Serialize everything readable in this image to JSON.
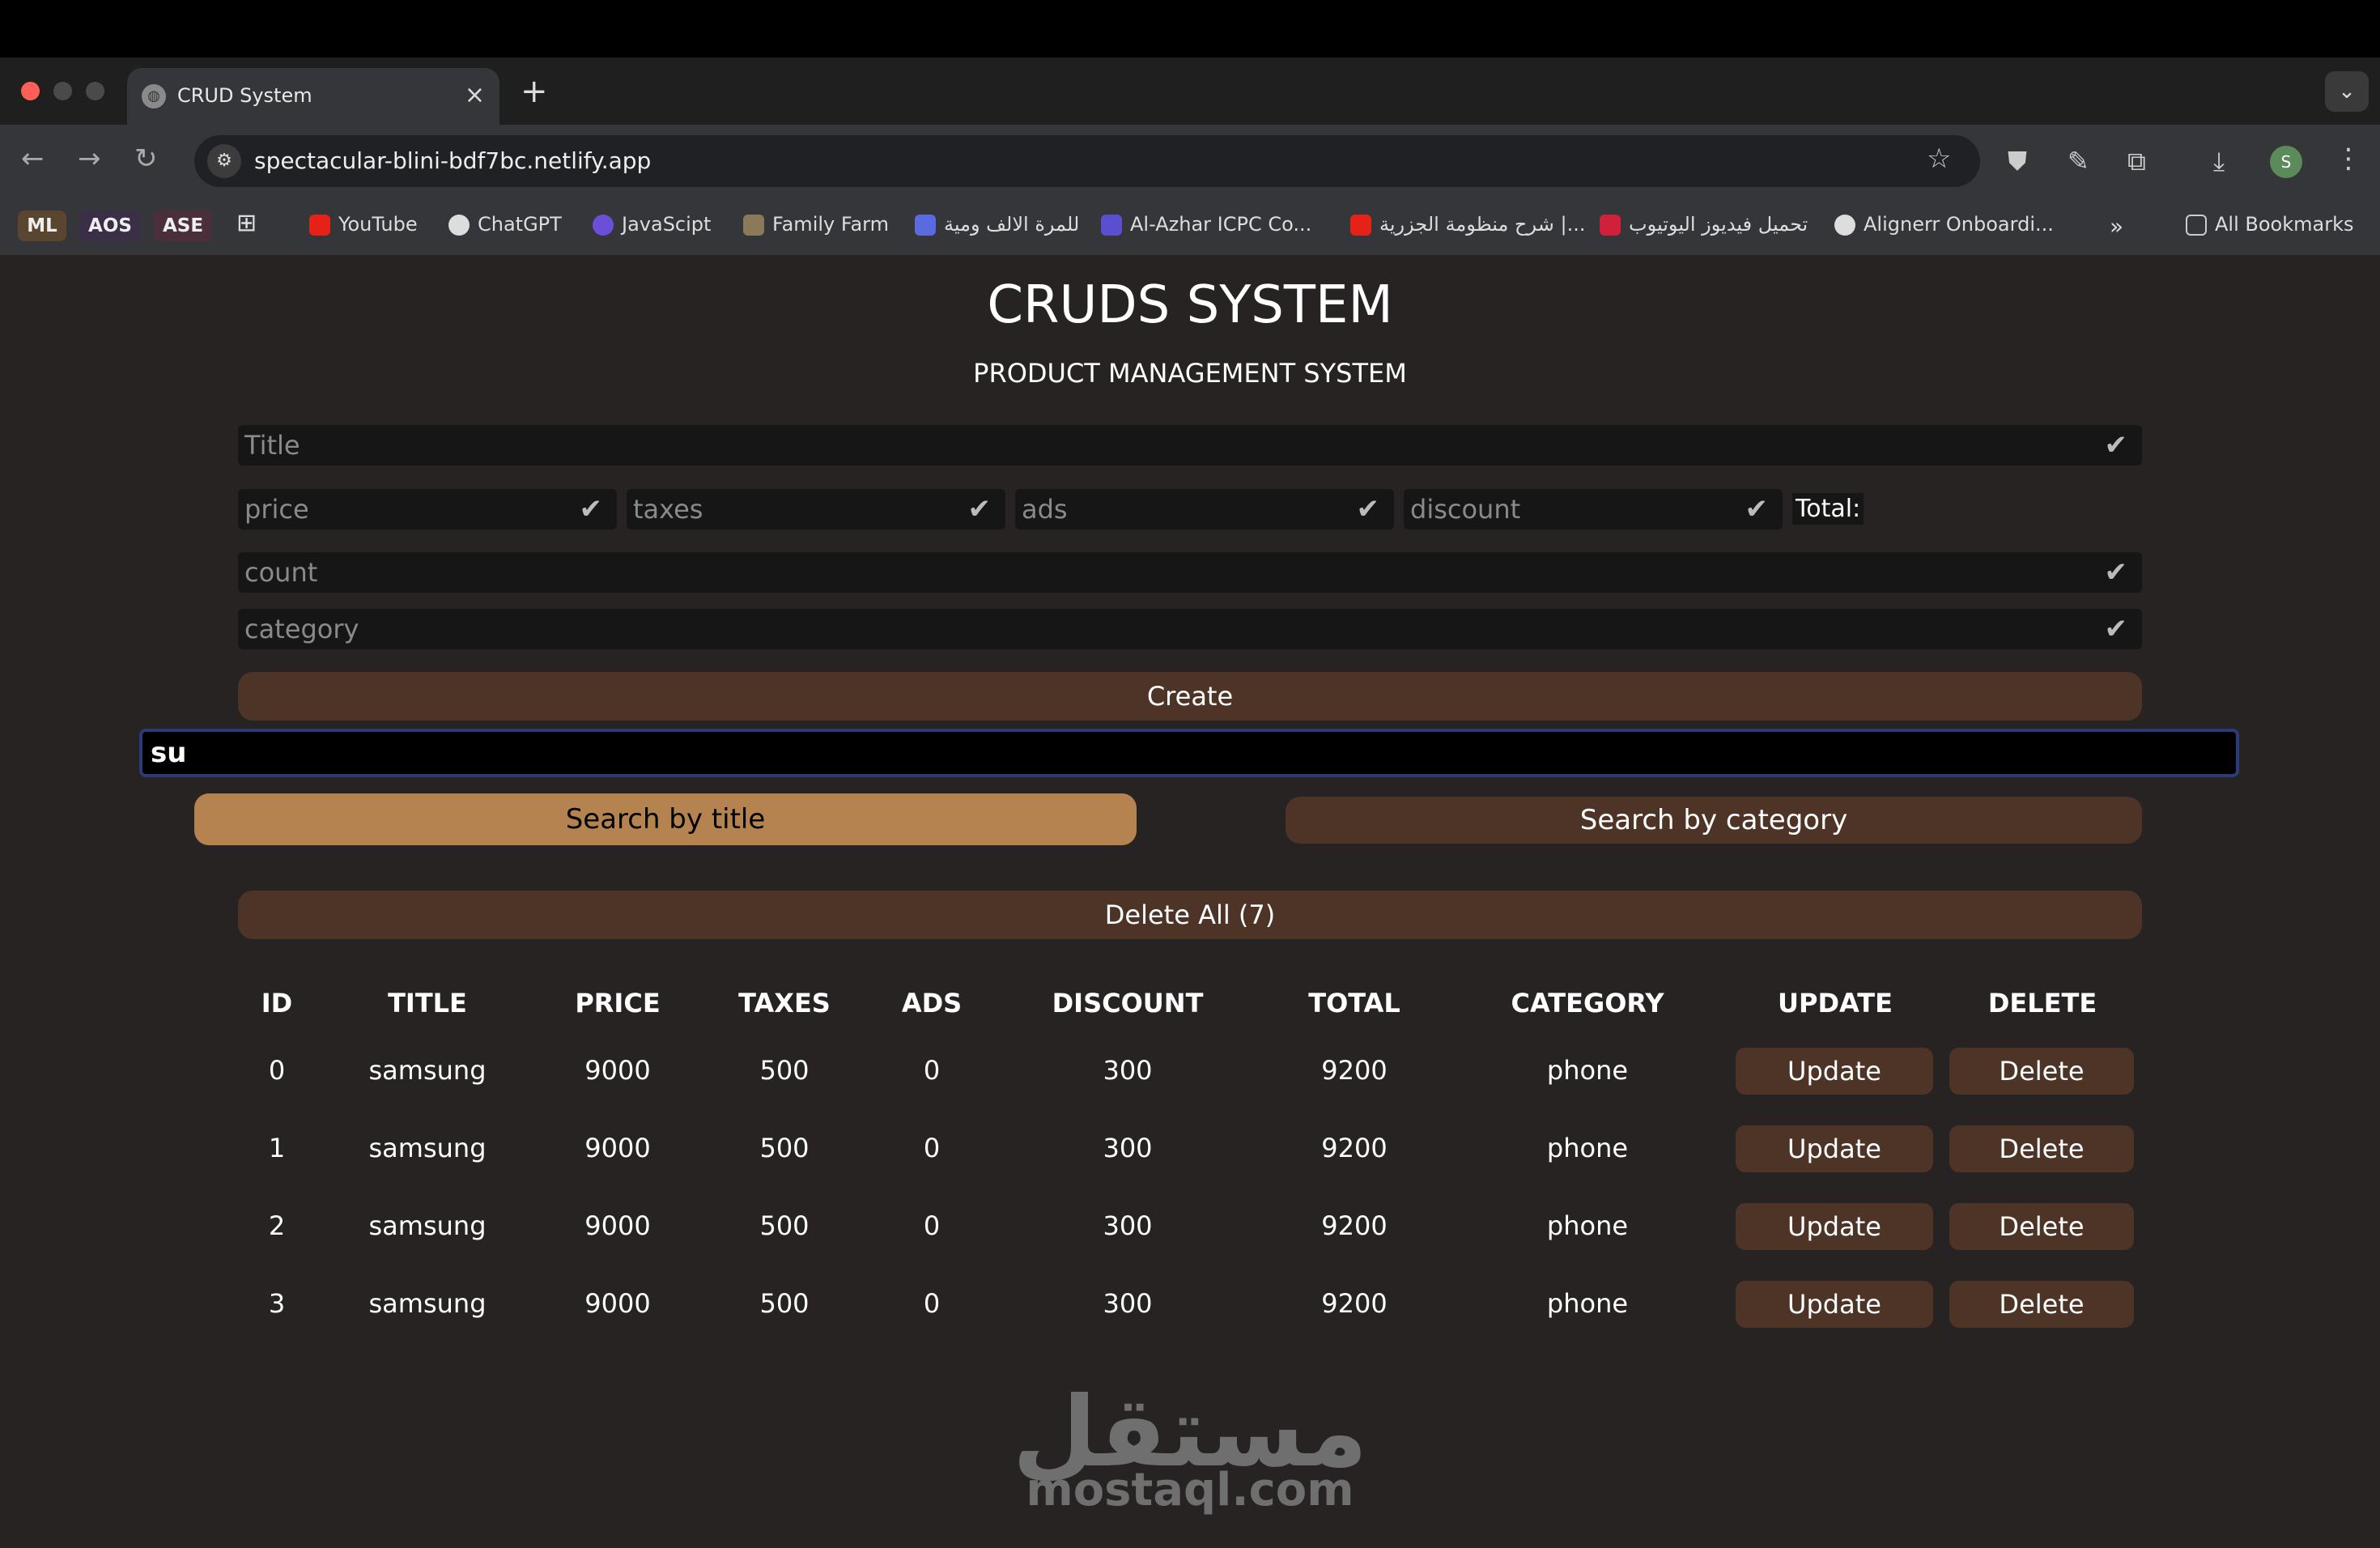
{
  "browser": {
    "tab_title": "CRUD System",
    "url": "spectacular-blini-bdf7bc.netlify.app",
    "bookmarks": [
      "ML",
      "AOS",
      "ASE",
      "YouTube",
      "ChatGPT",
      "JavaScipt",
      "Family Farm",
      "للمرة الالف ومية",
      "Al-Azhar ICPC Co...",
      "شرح منظومة الجزرية |...",
      "تحميل فيديوز اليوتيوب",
      "Alignerr Onboardi...",
      "All Bookmarks"
    ],
    "profile_initial": "S"
  },
  "app": {
    "title": "CRUDS SYSTEM",
    "subtitle": "PRODUCT MANAGEMENT SYSTEM",
    "inputs": {
      "title_placeholder": "Title",
      "price_placeholder": "price",
      "taxes_placeholder": "taxes",
      "ads_placeholder": "ads",
      "discount_placeholder": "discount",
      "count_placeholder": "count",
      "category_placeholder": "category"
    },
    "total_label": "Total:",
    "create_label": "Create",
    "search_value": "su",
    "search_by_title": "Search by title",
    "search_by_category": "Search by category",
    "delete_all_label": "Delete All (7)",
    "table": {
      "headers": [
        "ID",
        "TITLE",
        "PRICE",
        "TAXES",
        "ADS",
        "DISCOUNT",
        "TOTAL",
        "CATEGORY",
        "UPDATE",
        "DELETE"
      ],
      "rows": [
        {
          "id": "0",
          "title": "samsung",
          "price": "9000",
          "taxes": "500",
          "ads": "0",
          "discount": "300",
          "total": "9200",
          "category": "phone"
        },
        {
          "id": "1",
          "title": "samsung",
          "price": "9000",
          "taxes": "500",
          "ads": "0",
          "discount": "300",
          "total": "9200",
          "category": "phone"
        },
        {
          "id": "2",
          "title": "samsung",
          "price": "9000",
          "taxes": "500",
          "ads": "0",
          "discount": "300",
          "total": "9200",
          "category": "phone"
        },
        {
          "id": "3",
          "title": "samsung",
          "price": "9000",
          "taxes": "500",
          "ads": "0",
          "discount": "300",
          "total": "9200",
          "category": "phone"
        }
      ],
      "update_label": "Update",
      "delete_label": "Delete"
    }
  },
  "watermark": {
    "arabic": "مستقل",
    "latin": "mostaql.com"
  }
}
